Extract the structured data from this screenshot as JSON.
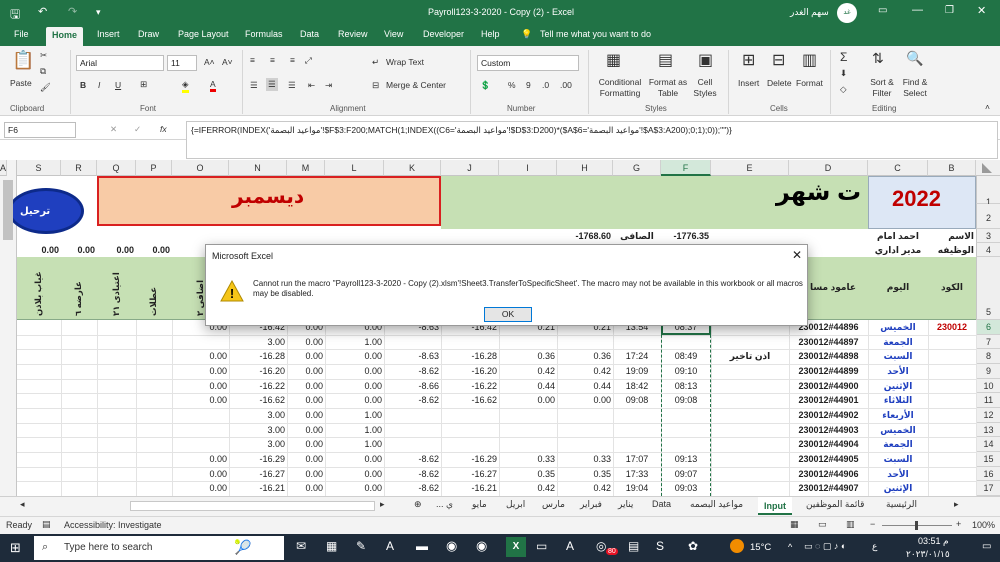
{
  "titlebar": {
    "doc_title": "Payroll123-3-2020 - Copy (2)  -  Excel",
    "user_name": "سهم الغدر",
    "user_initials": "غد"
  },
  "menu": [
    "File",
    "Home",
    "Insert",
    "Draw",
    "Page Layout",
    "Formulas",
    "Data",
    "Review",
    "View",
    "Developer",
    "Help",
    "Tell me what you want to do"
  ],
  "ribbon": {
    "paste": "Paste",
    "font_name": "Arial",
    "font_size": "11",
    "wrap_text": "Wrap Text",
    "merge_center": "Merge & Center",
    "number_format": "Custom",
    "conditional_formatting": "Conditional Formatting",
    "format_as_table": "Format as Table",
    "cell_styles": "Cell Styles",
    "insert": "Insert",
    "delete": "Delete",
    "format": "Format",
    "sort_filter": "Sort & Filter",
    "find_select": "Find & Select",
    "groups": {
      "clipboard": "Clipboard",
      "font": "Font",
      "alignment": "Alignment",
      "number": "Number",
      "styles": "Styles",
      "cells": "Cells",
      "editing": "Editing"
    }
  },
  "formula_bar": {
    "name_box": "F6",
    "formula": "{=IFERROR(INDEX('مواعيد البصمة'!$F$3:F200;MATCH(1;INDEX((C6='مواعيد البصمة'!$D$3:D200)*($A$6='مواعيد البصمة'!$A$3:A200);0;1);0));\"\")}"
  },
  "columns": [
    "S",
    "R",
    "Q",
    "P",
    "O",
    "N",
    "M",
    "L",
    "K",
    "J",
    "I",
    "H",
    "G",
    "F",
    "E",
    "D",
    "C",
    "B",
    "A"
  ],
  "selected_column": "F",
  "rows": [
    "1",
    "2",
    "3",
    "4",
    "5",
    "6",
    "7",
    "8",
    "9",
    "10",
    "11",
    "12",
    "13",
    "14",
    "15",
    "16",
    "17"
  ],
  "selected_row": "6",
  "header_block": {
    "year": "2022",
    "month_title": "ت شهر",
    "december": "ديسمبر",
    "transfer_button": "ترحيل",
    "name_label": "الاسم",
    "name_value": "احمد امام",
    "job_label": "الوظيفه",
    "job_value": "مدير اداري",
    "net_label": "الصافى",
    "net_value": "-1776.35",
    "h3_value": "-1768.60",
    "row4_zeros": [
      "0.00",
      "0.00",
      "0.00",
      "0.00",
      "0.0"
    ],
    "code_header": "الكود",
    "day_header": "اليوم",
    "device_header": "عامود مسا",
    "col_headers_left": [
      "غياب بلاذن",
      "عارضه ٦",
      "اعتيادى ٢١",
      "عطلات",
      "اضافى ٢"
    ]
  },
  "employee_code": "230012",
  "data_rows": [
    {
      "row": "6",
      "O": "0.00",
      "N": "-16.42",
      "M": "0.00",
      "L": "0.00",
      "K": "-8.63",
      "J": "-16.42",
      "I": "0.21",
      "H": "0.21",
      "G": "13:54",
      "F": "08:37",
      "E": "",
      "D": "230012#44896",
      "C": "الخميس"
    },
    {
      "row": "7",
      "O": "",
      "N": "3.00",
      "M": "0.00",
      "L": "1.00",
      "K": "",
      "J": "",
      "I": "",
      "H": "",
      "G": "",
      "F": "",
      "E": "",
      "D": "230012#44897",
      "C": "الجمعة"
    },
    {
      "row": "8",
      "O": "0.00",
      "N": "-16.28",
      "M": "0.00",
      "L": "0.00",
      "K": "-8.63",
      "J": "-16.28",
      "I": "0.36",
      "H": "0.36",
      "G": "17:24",
      "F": "08:49",
      "E": "اذن تاخير",
      "D": "230012#44898",
      "C": "السبت"
    },
    {
      "row": "9",
      "O": "0.00",
      "N": "-16.20",
      "M": "0.00",
      "L": "0.00",
      "K": "-8.62",
      "J": "-16.20",
      "I": "0.42",
      "H": "0.42",
      "G": "19:09",
      "F": "09:10",
      "E": "",
      "D": "230012#44899",
      "C": "الأحد"
    },
    {
      "row": "10",
      "O": "0.00",
      "N": "-16.22",
      "M": "0.00",
      "L": "0.00",
      "K": "-8.66",
      "J": "-16.22",
      "I": "0.44",
      "H": "0.44",
      "G": "18:42",
      "F": "08:13",
      "E": "",
      "D": "230012#44900",
      "C": "الإثنين"
    },
    {
      "row": "11",
      "O": "0.00",
      "N": "-16.62",
      "M": "0.00",
      "L": "0.00",
      "K": "-8.62",
      "J": "-16.62",
      "I": "0.00",
      "H": "0.00",
      "G": "09:08",
      "F": "09:08",
      "E": "",
      "D": "230012#44901",
      "C": "الثلاثاء"
    },
    {
      "row": "12",
      "O": "",
      "N": "3.00",
      "M": "0.00",
      "L": "1.00",
      "K": "",
      "J": "",
      "I": "",
      "H": "",
      "G": "",
      "F": "",
      "E": "",
      "D": "230012#44902",
      "C": "الأربعاء"
    },
    {
      "row": "13",
      "O": "",
      "N": "3.00",
      "M": "0.00",
      "L": "1.00",
      "K": "",
      "J": "",
      "I": "",
      "H": "",
      "G": "",
      "F": "",
      "E": "",
      "D": "230012#44903",
      "C": "الخميس"
    },
    {
      "row": "14",
      "O": "",
      "N": "3.00",
      "M": "0.00",
      "L": "1.00",
      "K": "",
      "J": "",
      "I": "",
      "H": "",
      "G": "",
      "F": "",
      "E": "",
      "D": "230012#44904",
      "C": "الجمعة"
    },
    {
      "row": "15",
      "O": "0.00",
      "N": "-16.29",
      "M": "0.00",
      "L": "0.00",
      "K": "-8.62",
      "J": "-16.29",
      "I": "0.33",
      "H": "0.33",
      "G": "17:07",
      "F": "09:13",
      "E": "",
      "D": "230012#44905",
      "C": "السبت"
    },
    {
      "row": "16",
      "O": "0.00",
      "N": "-16.27",
      "M": "0.00",
      "L": "0.00",
      "K": "-8.62",
      "J": "-16.27",
      "I": "0.35",
      "H": "0.35",
      "G": "17:33",
      "F": "09:07",
      "E": "",
      "D": "230012#44906",
      "C": "الأحد"
    },
    {
      "row": "17",
      "O": "0.00",
      "N": "-16.21",
      "M": "0.00",
      "L": "0.00",
      "K": "-8.62",
      "J": "-16.21",
      "I": "0.42",
      "H": "0.42",
      "G": "19:04",
      "F": "09:03",
      "E": "",
      "D": "230012#44907",
      "C": "الإثنين"
    }
  ],
  "sheet_tabs": [
    "الرئيسية",
    "قائمة الموظفين",
    "Input",
    "مواعيد البصمه",
    "Data",
    "يناير",
    "فبراير",
    "مارس",
    "ابريل",
    "مايو",
    "... ي"
  ],
  "active_sheet": "Input",
  "dialog": {
    "title": "Microsoft Excel",
    "message": "Cannot run the macro ''Payroll123-3-2020 - Copy (2).xlsm'!Sheet3.TransferToSpecificSheet'. The macro may not be available in this workbook or all macros may be disabled.",
    "ok": "OK"
  },
  "status": {
    "ready": "Ready",
    "accessibility": "Accessibility: Investigate",
    "zoom": "100%"
  },
  "taskbar": {
    "search_placeholder": "Type here to search",
    "weather": "15°C",
    "time": "03:51 م",
    "date": "٢٠٢٣/٠١/١٥",
    "lang": "ع",
    "badge": "80"
  },
  "colors": {
    "excel_green": "#217346",
    "header_green": "#c6e0b4",
    "orange": "#f8cba6",
    "blue_button": "#1f3fbf",
    "year_red": "#c00000"
  }
}
